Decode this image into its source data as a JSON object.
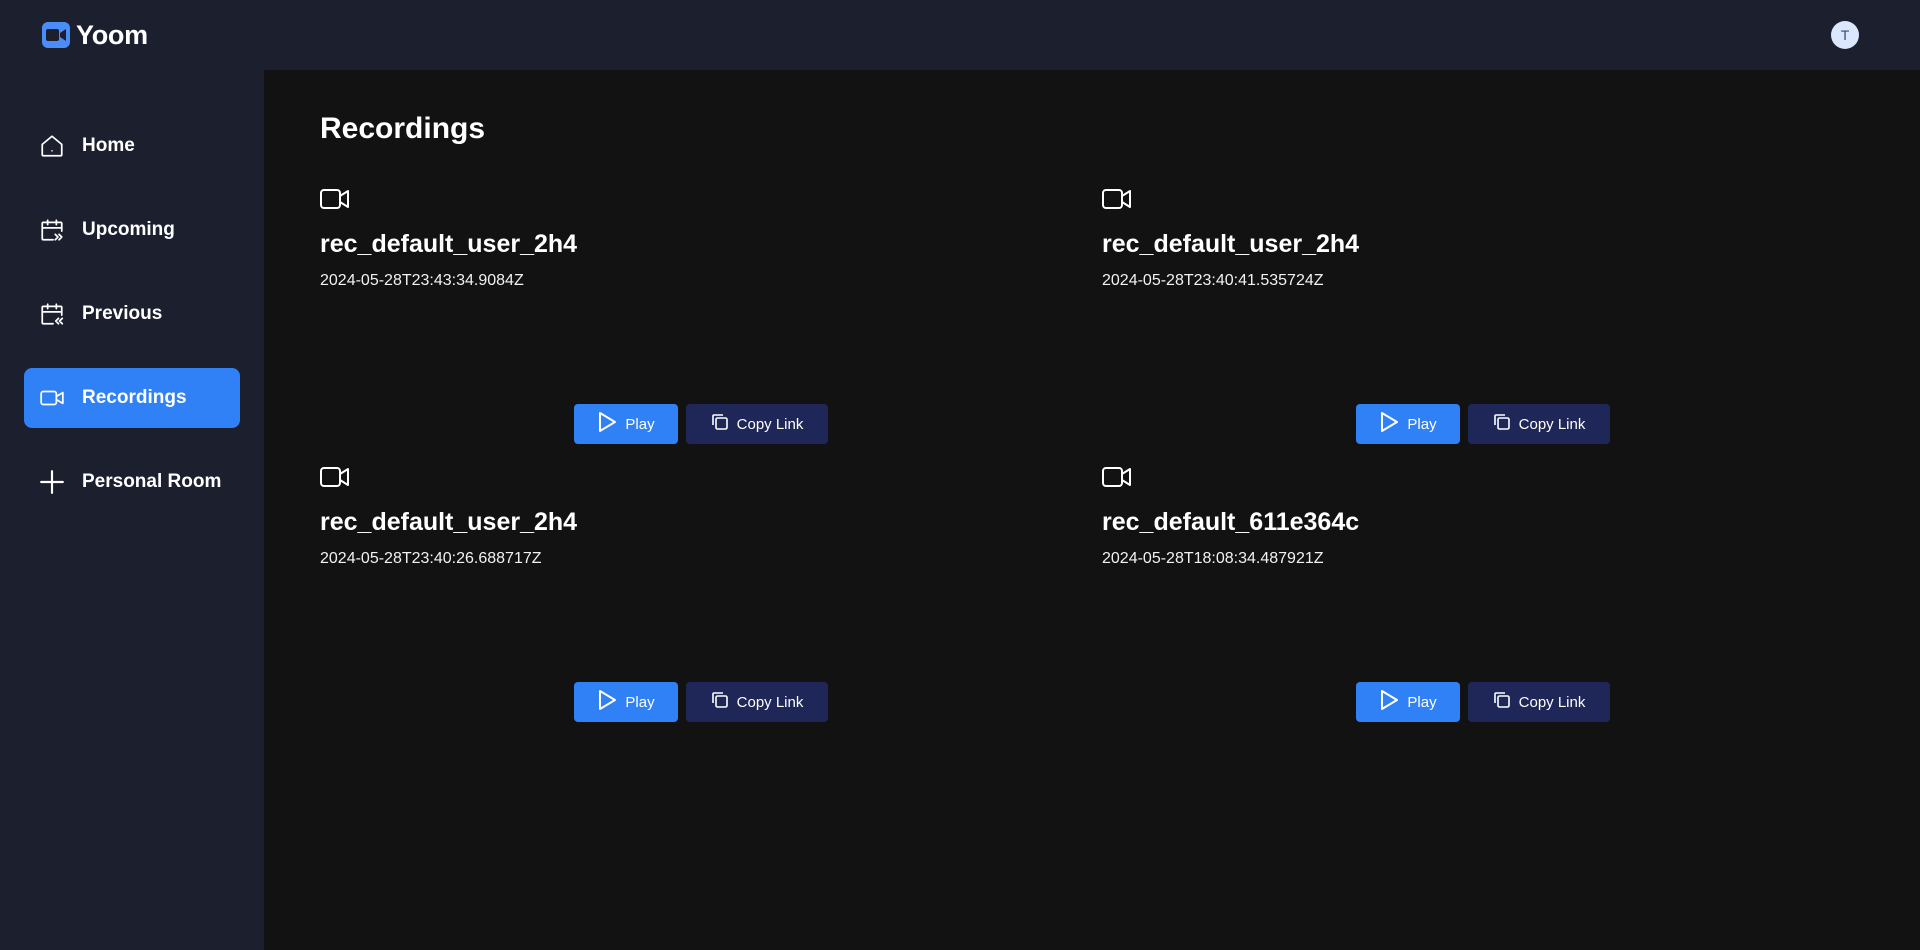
{
  "app": {
    "name": "Yoom",
    "avatar_initial": "T"
  },
  "colors": {
    "accent": "#3081f6",
    "topbar": "#1c1f2e",
    "main_bg": "#121212",
    "copy_button": "#1e2757"
  },
  "sidebar": {
    "items": [
      {
        "label": "Home",
        "icon": "home-icon",
        "active": false
      },
      {
        "label": "Upcoming",
        "icon": "calendar-upcoming-icon",
        "active": false
      },
      {
        "label": "Previous",
        "icon": "calendar-previous-icon",
        "active": false
      },
      {
        "label": "Recordings",
        "icon": "video-icon",
        "active": true
      },
      {
        "label": "Personal Room",
        "icon": "plus-icon",
        "active": false
      }
    ]
  },
  "main": {
    "title": "Recordings",
    "recordings": [
      {
        "name": "rec_default_user_2h4",
        "date": "2024-05-28T23:43:34.9084Z",
        "play_label": "Play",
        "copy_label": "Copy Link"
      },
      {
        "name": "rec_default_user_2h4",
        "date": "2024-05-28T23:40:41.535724Z",
        "play_label": "Play",
        "copy_label": "Copy Link"
      },
      {
        "name": "rec_default_user_2h4",
        "date": "2024-05-28T23:40:26.688717Z",
        "play_label": "Play",
        "copy_label": "Copy Link"
      },
      {
        "name": "rec_default_611e364c",
        "date": "2024-05-28T18:08:34.487921Z",
        "play_label": "Play",
        "copy_label": "Copy Link"
      }
    ]
  }
}
